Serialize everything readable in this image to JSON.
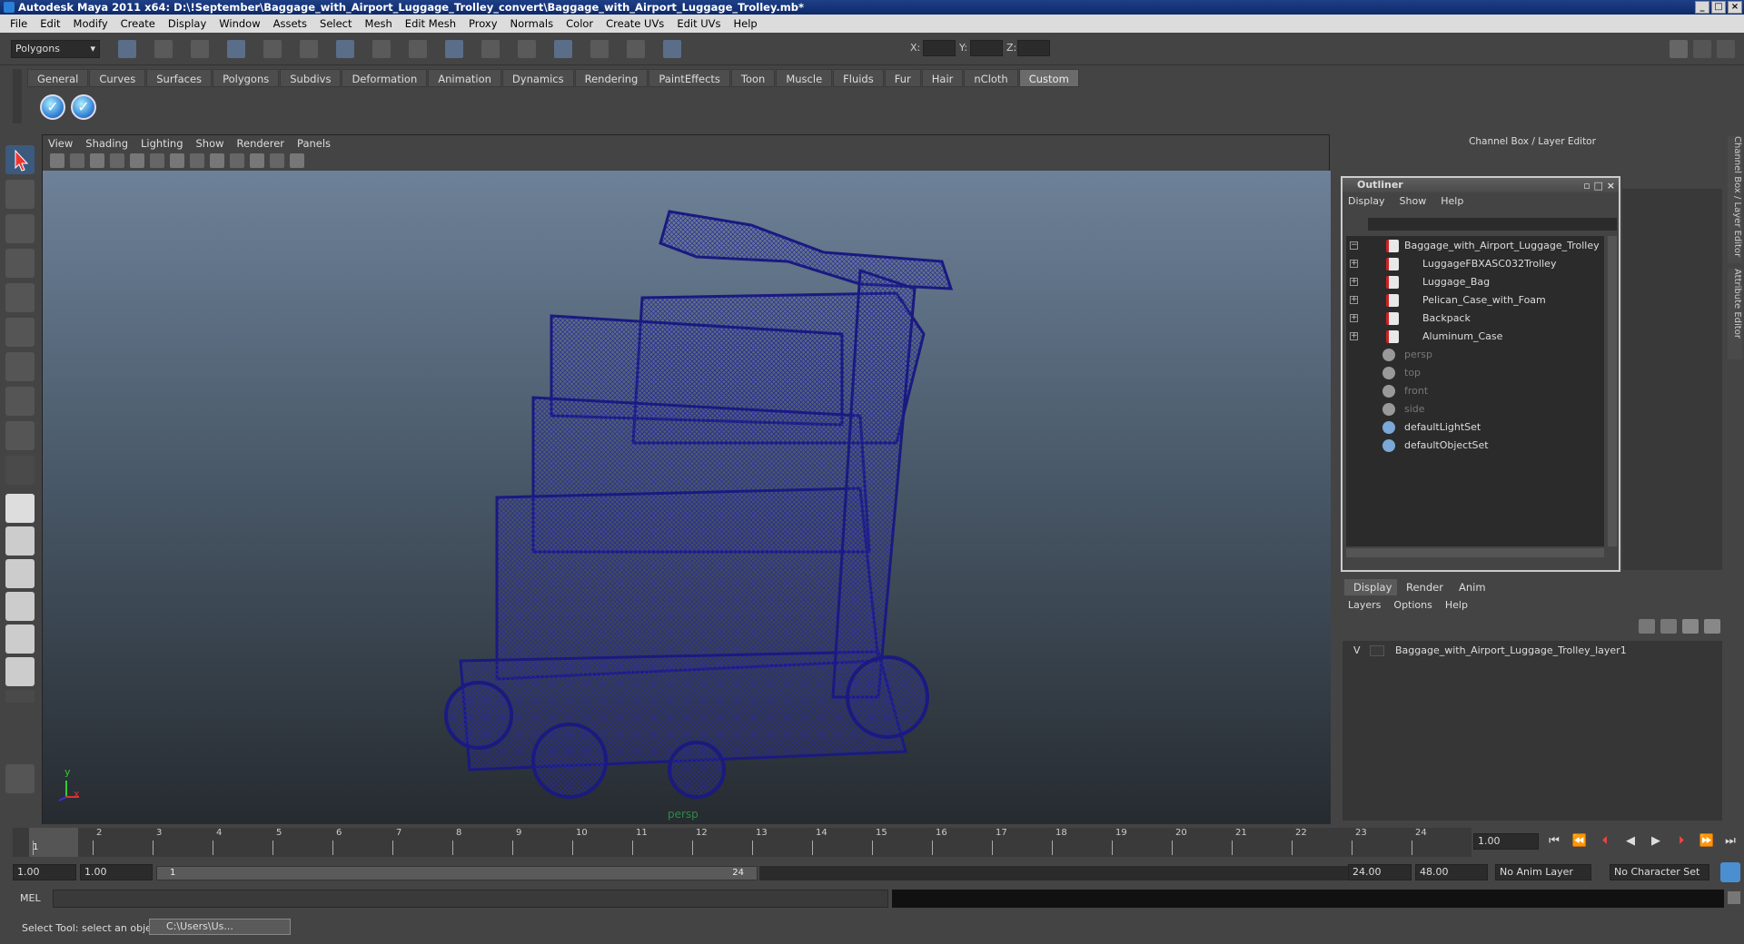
{
  "window": {
    "title": "Autodesk Maya 2011 x64: D:\\!September\\Baggage_with_Airport_Luggage_Trolley_convert\\Baggage_with_Airport_Luggage_Trolley.mb*"
  },
  "menu": [
    "File",
    "Edit",
    "Modify",
    "Create",
    "Display",
    "Window",
    "Assets",
    "Select",
    "Mesh",
    "Edit Mesh",
    "Proxy",
    "Normals",
    "Color",
    "Create UVs",
    "Edit UVs",
    "Help"
  ],
  "status": {
    "mode": "Polygons",
    "x_label": "X:",
    "y_label": "Y:",
    "z_label": "Z:"
  },
  "shelf": {
    "tabs": [
      "General",
      "Curves",
      "Surfaces",
      "Polygons",
      "Subdivs",
      "Deformation",
      "Animation",
      "Dynamics",
      "Rendering",
      "PaintEffects",
      "Toon",
      "Muscle",
      "Fluids",
      "Fur",
      "Hair",
      "nCloth",
      "Custom"
    ],
    "active": "Custom"
  },
  "viewport": {
    "menu": [
      "View",
      "Shading",
      "Lighting",
      "Show",
      "Renderer",
      "Panels"
    ],
    "camera_label": "persp",
    "axis_x": "x",
    "axis_y": "y",
    "wire_color": "#1a1a80"
  },
  "channel_box": {
    "title": "Channel Box / Layer Editor",
    "side_tabs": [
      "Channel Box / Layer Editor",
      "Attribute Editor"
    ]
  },
  "outliner": {
    "title": "Outliner",
    "menu": [
      "Display",
      "Show",
      "Help"
    ],
    "items": [
      {
        "label": "Baggage_with_Airport_Luggage_Trolley",
        "expander": "−",
        "dim": false,
        "kind": "mesh",
        "indent": 0
      },
      {
        "label": "LuggageFBXASC032Trolley",
        "expander": "+",
        "dim": false,
        "kind": "mesh",
        "indent": 1
      },
      {
        "label": "Luggage_Bag",
        "expander": "+",
        "dim": false,
        "kind": "mesh",
        "indent": 1
      },
      {
        "label": "Pelican_Case_with_Foam",
        "expander": "+",
        "dim": false,
        "kind": "mesh",
        "indent": 1
      },
      {
        "label": "Backpack",
        "expander": "+",
        "dim": false,
        "kind": "mesh",
        "indent": 1
      },
      {
        "label": "Aluminum_Case",
        "expander": "+",
        "dim": false,
        "kind": "mesh",
        "indent": 1
      },
      {
        "label": "persp",
        "expander": "",
        "dim": true,
        "kind": "camera",
        "indent": 0
      },
      {
        "label": "top",
        "expander": "",
        "dim": true,
        "kind": "camera",
        "indent": 0
      },
      {
        "label": "front",
        "expander": "",
        "dim": true,
        "kind": "camera",
        "indent": 0
      },
      {
        "label": "side",
        "expander": "",
        "dim": true,
        "kind": "camera",
        "indent": 0
      },
      {
        "label": "defaultLightSet",
        "expander": "",
        "dim": false,
        "kind": "set",
        "indent": 0
      },
      {
        "label": "defaultObjectSet",
        "expander": "",
        "dim": false,
        "kind": "set",
        "indent": 0
      }
    ]
  },
  "layer_editor": {
    "tabs": [
      "Display",
      "Render",
      "Anim"
    ],
    "active": "Display",
    "menu": [
      "Layers",
      "Options",
      "Help"
    ],
    "layers": [
      {
        "visible": "V",
        "name": "Baggage_with_Airport_Luggage_Trolley_layer1"
      }
    ]
  },
  "timeline": {
    "ticks": [
      "1",
      "2",
      "3",
      "4",
      "5",
      "6",
      "7",
      "8",
      "9",
      "10",
      "11",
      "12",
      "13",
      "14",
      "15",
      "16",
      "17",
      "18",
      "19",
      "20",
      "21",
      "22",
      "23",
      "24"
    ],
    "current_frame": "1",
    "current_time": "1.00"
  },
  "range": {
    "start": "1.00",
    "inner_start": "1.00",
    "slider_start": "1",
    "slider_end": "24",
    "end": "24.00",
    "outer_end": "48.00",
    "anim_layer": "No Anim Layer",
    "character_set": "No Character Set"
  },
  "command": {
    "label": "MEL"
  },
  "help": {
    "text": "Select Tool: select an object",
    "task": "C:\\Users\\Us..."
  }
}
